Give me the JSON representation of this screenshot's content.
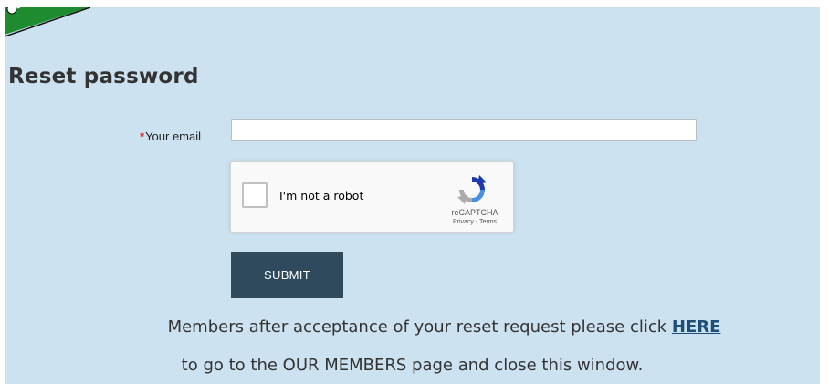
{
  "page": {
    "title": "Reset password"
  },
  "form": {
    "required_mark": "*",
    "email_label": "Your email",
    "email_value": "",
    "email_placeholder": "",
    "submit_label": "SUBMIT"
  },
  "captcha": {
    "checkbox_label": "I'm not a robot",
    "brand": "reCAPTCHA",
    "privacy_link": "Privacy",
    "separator": " - ",
    "terms_link": "Terms",
    "checked": false
  },
  "info": {
    "line1_text": "Members  after acceptance of your reset request please click ",
    "line1_link": "HERE",
    "line2_text": "to go to the OUR MEMBERS page  and close this window."
  },
  "colors": {
    "background": "#cce2f1",
    "submit": "#2e4a5c",
    "required": "#e02020",
    "link": "#1f4e79",
    "logo_green": "#1e8c2e"
  }
}
